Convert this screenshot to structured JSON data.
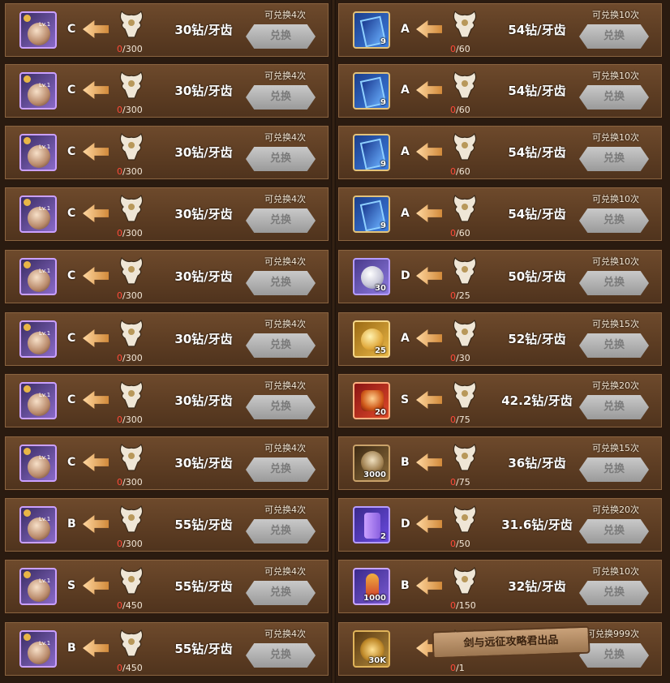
{
  "left_rows": [
    {
      "icon": "hero-portrait-icon",
      "lv": "Lv.1",
      "grade": "C",
      "price": "30钻/牙齿",
      "progress_current": "0",
      "progress_total": "/300",
      "limit": "可兑换4次",
      "button": "兑换"
    },
    {
      "icon": "hero-portrait-icon",
      "lv": "Lv.1",
      "grade": "C",
      "price": "30钻/牙齿",
      "progress_current": "0",
      "progress_total": "/300",
      "limit": "可兑换4次",
      "button": "兑换"
    },
    {
      "icon": "hero-portrait-icon",
      "lv": "Lv.1",
      "grade": "C",
      "price": "30钻/牙齿",
      "progress_current": "0",
      "progress_total": "/300",
      "limit": "可兑换4次",
      "button": "兑换"
    },
    {
      "icon": "hero-portrait-icon",
      "lv": "Lv.1",
      "grade": "C",
      "price": "30钻/牙齿",
      "progress_current": "0",
      "progress_total": "/300",
      "limit": "可兑换4次",
      "button": "兑换"
    },
    {
      "icon": "hero-portrait-icon",
      "lv": "Lv.1",
      "grade": "C",
      "price": "30钻/牙齿",
      "progress_current": "0",
      "progress_total": "/300",
      "limit": "可兑换4次",
      "button": "兑换"
    },
    {
      "icon": "hero-portrait-icon",
      "lv": "Lv.1",
      "grade": "C",
      "price": "30钻/牙齿",
      "progress_current": "0",
      "progress_total": "/300",
      "limit": "可兑换4次",
      "button": "兑换"
    },
    {
      "icon": "hero-portrait-icon",
      "lv": "Lv.1",
      "grade": "C",
      "price": "30钻/牙齿",
      "progress_current": "0",
      "progress_total": "/300",
      "limit": "可兑换4次",
      "button": "兑换"
    },
    {
      "icon": "hero-portrait-icon",
      "lv": "Lv.1",
      "grade": "C",
      "price": "30钻/牙齿",
      "progress_current": "0",
      "progress_total": "/300",
      "limit": "可兑换4次",
      "button": "兑换"
    },
    {
      "icon": "hero-portrait-icon",
      "lv": "Lv.1",
      "grade": "B",
      "price": "55钻/牙齿",
      "progress_current": "0",
      "progress_total": "/300",
      "limit": "可兑换4次",
      "button": "兑换"
    },
    {
      "icon": "hero-portrait-icon",
      "lv": "Lv.1",
      "grade": "S",
      "price": "55钻/牙齿",
      "progress_current": "0",
      "progress_total": "/450",
      "limit": "可兑换4次",
      "button": "兑换"
    },
    {
      "icon": "hero-portrait-icon",
      "lv": "Lv.1",
      "grade": "B",
      "price": "55钻/牙齿",
      "progress_current": "0",
      "progress_total": "/450",
      "limit": "可兑换4次",
      "button": "兑换"
    }
  ],
  "right_rows": [
    {
      "icon": "card-icon",
      "qty": "9",
      "grade": "A",
      "price": "54钻/牙齿",
      "progress_current": "0",
      "progress_total": "/60",
      "limit": "可兑换10次",
      "button": "兑换"
    },
    {
      "icon": "card-icon",
      "qty": "9",
      "grade": "A",
      "price": "54钻/牙齿",
      "progress_current": "0",
      "progress_total": "/60",
      "limit": "可兑换10次",
      "button": "兑换"
    },
    {
      "icon": "card-icon",
      "qty": "9",
      "grade": "A",
      "price": "54钻/牙齿",
      "progress_current": "0",
      "progress_total": "/60",
      "limit": "可兑换10次",
      "button": "兑换"
    },
    {
      "icon": "card-icon",
      "qty": "9",
      "grade": "A",
      "price": "54钻/牙齿",
      "progress_current": "0",
      "progress_total": "/60",
      "limit": "可兑换10次",
      "button": "兑换"
    },
    {
      "icon": "silver-gem-icon",
      "qty": "30",
      "grade": "D",
      "price": "50钻/牙齿",
      "progress_current": "0",
      "progress_total": "/25",
      "limit": "可兑换10次",
      "button": "兑换"
    },
    {
      "icon": "gold-coin-icon",
      "qty": "25",
      "grade": "A",
      "price": "52钻/牙齿",
      "progress_current": "0",
      "progress_total": "/30",
      "limit": "可兑换15次",
      "button": "兑换"
    },
    {
      "icon": "treasure-chest-icon",
      "qty": "20",
      "grade": "S",
      "price": "42.2钻/牙齿",
      "progress_current": "0",
      "progress_total": "/75",
      "limit": "可兑换20次",
      "button": "兑换"
    },
    {
      "icon": "skull-coin-icon",
      "qty": "3000",
      "grade": "B",
      "price": "36钻/牙齿",
      "progress_current": "0",
      "progress_total": "/75",
      "limit": "可兑换15次",
      "button": "兑换"
    },
    {
      "icon": "scroll-icon",
      "qty": "2",
      "grade": "D",
      "price": "31.6钻/牙齿",
      "progress_current": "0",
      "progress_total": "/50",
      "limit": "可兑换20次",
      "button": "兑换"
    },
    {
      "icon": "potion-icon",
      "qty": "1000",
      "grade": "B",
      "price": "32钻/牙齿",
      "progress_current": "0",
      "progress_total": "/150",
      "limit": "可兑换10次",
      "button": "兑换"
    },
    {
      "icon": "compass-coin-icon",
      "qty": "30K",
      "grade": "",
      "price": "",
      "progress_current": "0",
      "progress_total": "/1",
      "limit": "可兑换999次",
      "button": "兑换",
      "watermark": "剑与远征攻略君出品"
    }
  ]
}
